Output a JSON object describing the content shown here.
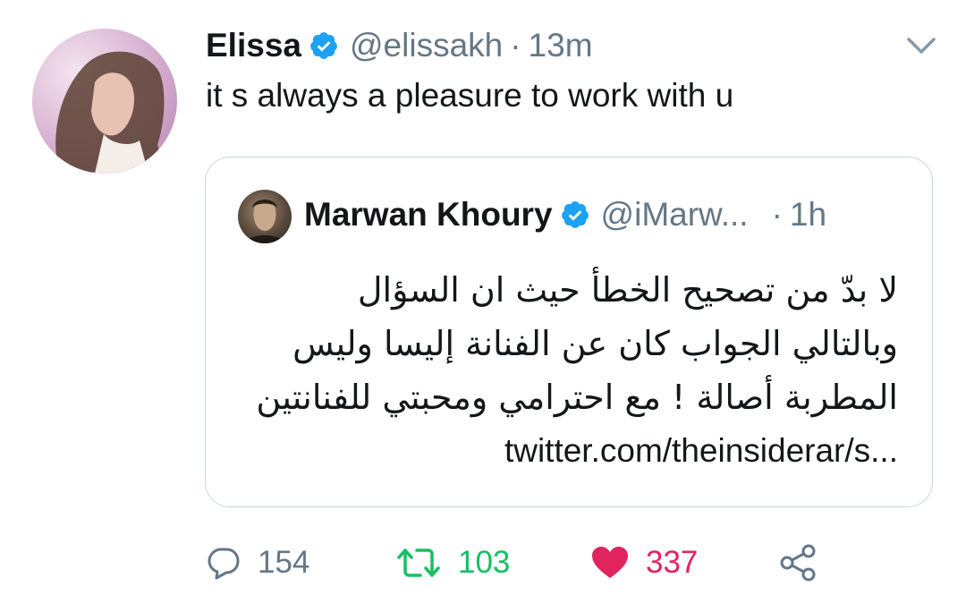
{
  "tweet": {
    "author_name": "Elissa",
    "author_handle": "@elissakh",
    "separator": "·",
    "time": "13m",
    "text": "it s always a pleasure to work with u",
    "avatar_icon": "elissa-avatar",
    "verified_icon": "verified-badge-icon",
    "menu_icon": "chevron-down-icon"
  },
  "quoted": {
    "author_name": "Marwan Khoury",
    "author_handle": "@iMarw...",
    "separator": "·",
    "time": "1h",
    "lines": [
      "لا بدّ من تصحيح الخطأ حيث ان السؤال",
      "وبالتالي الجواب كان عن الفنانة إليسا وليس",
      "المطربة أصالة ! مع احترامي ومحبتي للفنانتين"
    ],
    "link": "twitter.com/theinsiderar/s...",
    "avatar_icon": "marwan-avatar"
  },
  "actions": {
    "reply_count": "154",
    "retweet_count": "103",
    "like_count": "337",
    "reply_icon": "reply-icon",
    "retweet_icon": "retweet-icon",
    "like_icon": "heart-icon",
    "share_icon": "share-icon"
  },
  "colors": {
    "verified": "#1da1f2",
    "secondary_text": "#657786",
    "retweet_active": "#17bf63",
    "like_active": "#e0245e",
    "border": "#ccd6dd"
  }
}
